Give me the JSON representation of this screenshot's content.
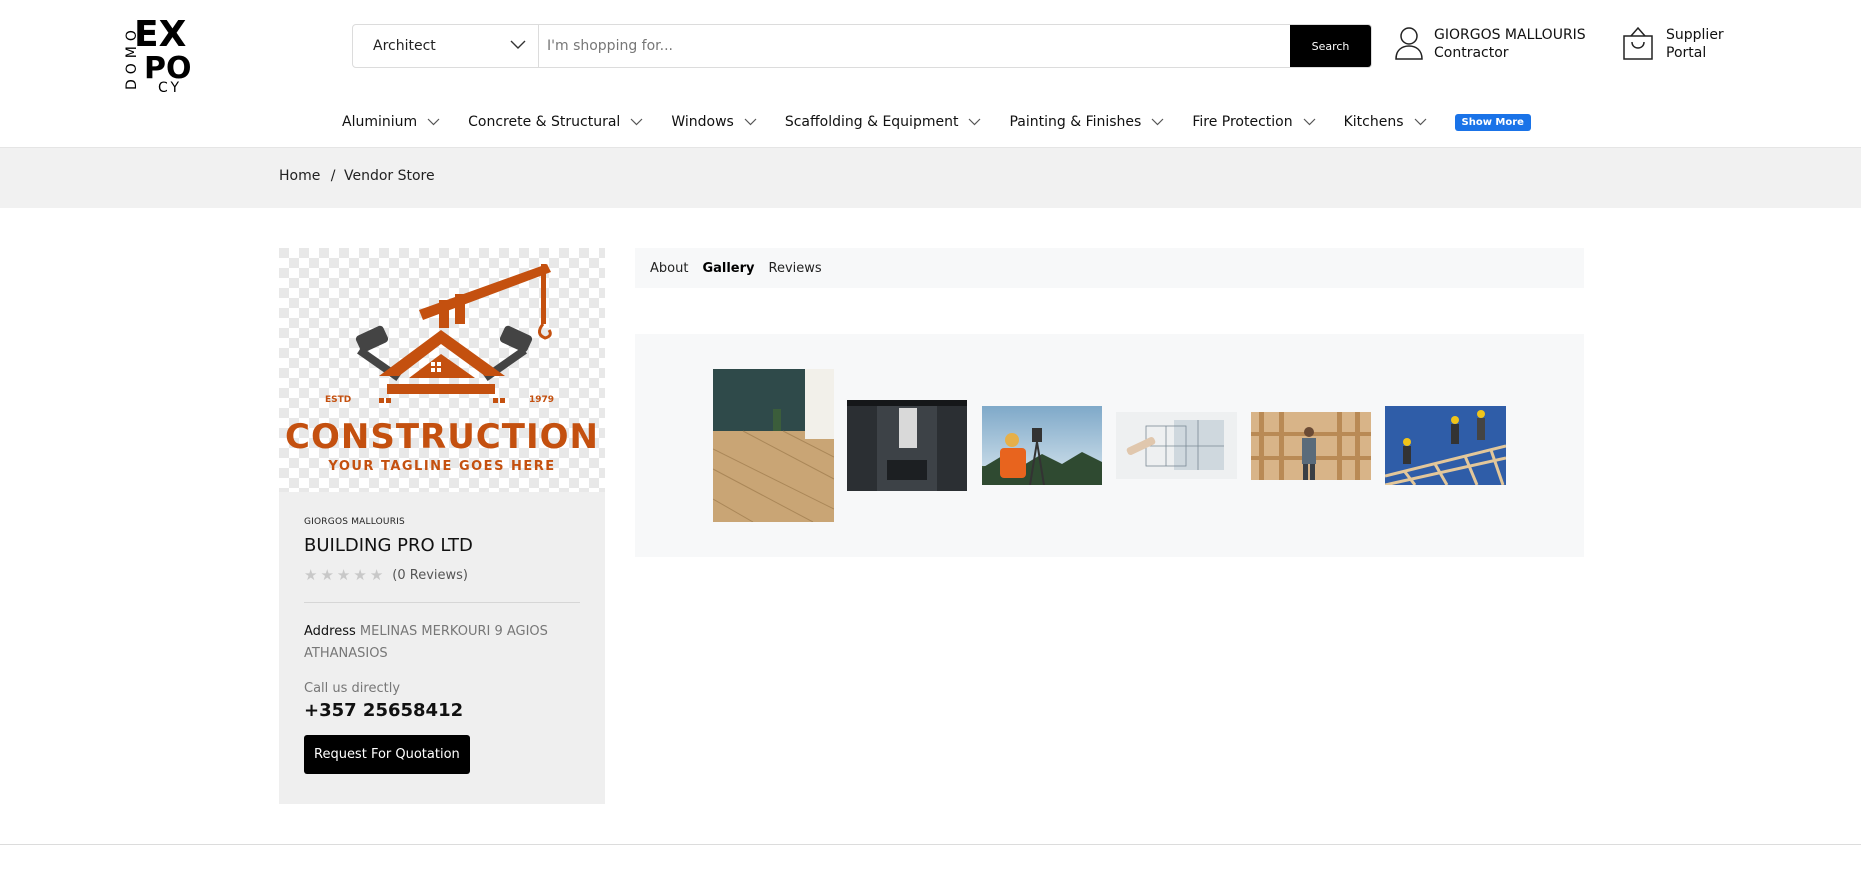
{
  "brand": {
    "logo_letters": [
      "D",
      "O",
      "M",
      "O",
      "EX",
      "PO",
      "CY"
    ]
  },
  "search": {
    "category": "Architect",
    "placeholder": "I'm shopping for...",
    "button_label": "Search"
  },
  "user": {
    "name": "GIORGOS MALLOURIS",
    "role": "Contractor",
    "icon": "user-icon"
  },
  "portal": {
    "line1": "Supplier",
    "line2": "Portal",
    "icon": "shopping-bag-icon"
  },
  "nav": {
    "items": [
      {
        "label": "Aluminium"
      },
      {
        "label": "Concrete & Structural"
      },
      {
        "label": "Windows"
      },
      {
        "label": "Scaffolding & Equipment"
      },
      {
        "label": "Painting & Finishes"
      },
      {
        "label": "Fire Protection"
      },
      {
        "label": "Kitchens"
      }
    ],
    "show_more": "Show More"
  },
  "breadcrumb": {
    "home": "Home",
    "separator": "/",
    "current": "Vendor Store"
  },
  "vendor": {
    "banner": {
      "estd": "ESTD",
      "year": "1979",
      "title": "CONSTRUCTION",
      "tagline": "YOUR TAGLINE GOES HERE"
    },
    "owner": "GIORGOS MALLOURIS",
    "name": "BUILDING PRO LTD",
    "rating": 0,
    "reviews_label": "(0 Reviews)",
    "address_label": "Address",
    "address_value": "MELINAS MERKOURI 9 AGIOS ATHANASIOS",
    "call_label": "Call us directly",
    "phone": "+357 25658412",
    "rfq_label": "Request For Quotation"
  },
  "tabs": [
    {
      "label": "About",
      "active": false
    },
    {
      "label": "Gallery",
      "active": true
    },
    {
      "label": "Reviews",
      "active": false
    }
  ],
  "gallery": {
    "images": [
      {
        "name": "wood-floor-photo"
      },
      {
        "name": "dark-bathroom-photo"
      },
      {
        "name": "surveyor-photo"
      },
      {
        "name": "architect-sketch-photo"
      },
      {
        "name": "timber-frame-worker-photo"
      },
      {
        "name": "roof-truss-workers-photo"
      }
    ]
  },
  "colors": {
    "accent": "#1a73e8",
    "brand_orange": "#c4500f",
    "button_black": "#000000"
  }
}
